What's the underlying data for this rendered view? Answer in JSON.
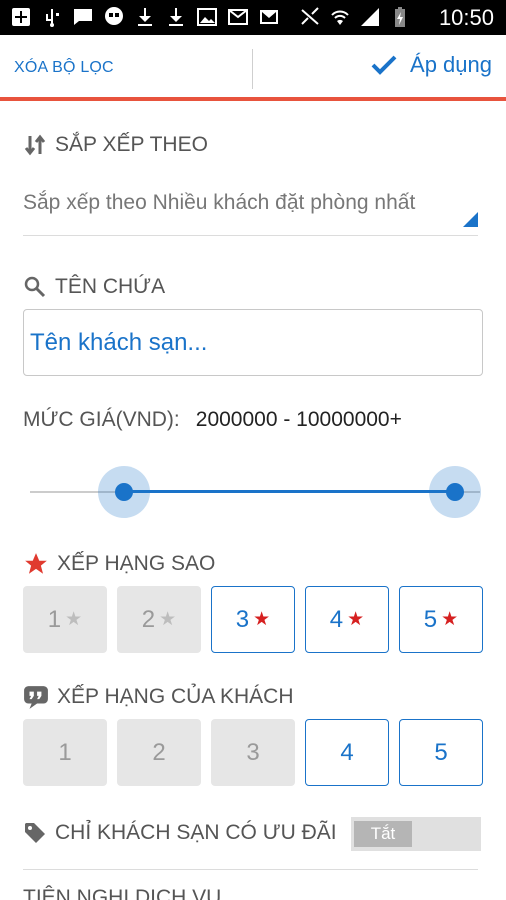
{
  "status_bar": {
    "time": "10:50",
    "left_icons": [
      "add-box-icon",
      "usb-icon",
      "message-icon",
      "hangouts-icon",
      "download-icon",
      "download-icon",
      "image-icon",
      "voicemail-mail-icon",
      "gmail-icon"
    ],
    "right_icons": [
      "nfc-icon",
      "wifi-icon",
      "signal-icon",
      "battery-icon"
    ]
  },
  "action_bar": {
    "clear_label": "XÓA BỘ LỌC",
    "apply_label": "Áp dụng"
  },
  "sort": {
    "title": "SẮP XẾP THEO",
    "selected": "Sắp xếp theo Nhiều khách đặt phòng nhất"
  },
  "name_filter": {
    "title": "TÊN CHỨA",
    "placeholder": "Tên khách sạn..."
  },
  "price": {
    "label": "MỨC GIÁ(VND):",
    "range_text": "2000000 - 10000000+",
    "slider_low_fraction": 0.22,
    "slider_high_fraction": 1.0
  },
  "star_rating": {
    "title": "XẾP HẠNG SAO",
    "options": [
      {
        "label": "1",
        "selected": false
      },
      {
        "label": "2",
        "selected": false
      },
      {
        "label": "3",
        "selected": true
      },
      {
        "label": "4",
        "selected": true
      },
      {
        "label": "5",
        "selected": true
      }
    ]
  },
  "guest_rating": {
    "title": "XẾP HẠNG CỦA KHÁCH",
    "options": [
      {
        "label": "1",
        "selected": false
      },
      {
        "label": "2",
        "selected": false
      },
      {
        "label": "3",
        "selected": false
      },
      {
        "label": "4",
        "selected": true
      },
      {
        "label": "5",
        "selected": true
      }
    ]
  },
  "deals": {
    "title": "CHỈ KHÁCH SẠN CÓ ƯU ĐÃI",
    "toggle_label": "Tắt",
    "enabled": false
  },
  "amenities": {
    "title": "TIỆN NGHI DỊCH VỤ"
  },
  "colors": {
    "accent": "#1a73c9",
    "divider_red": "#e8533d",
    "star_red": "#d62020"
  }
}
